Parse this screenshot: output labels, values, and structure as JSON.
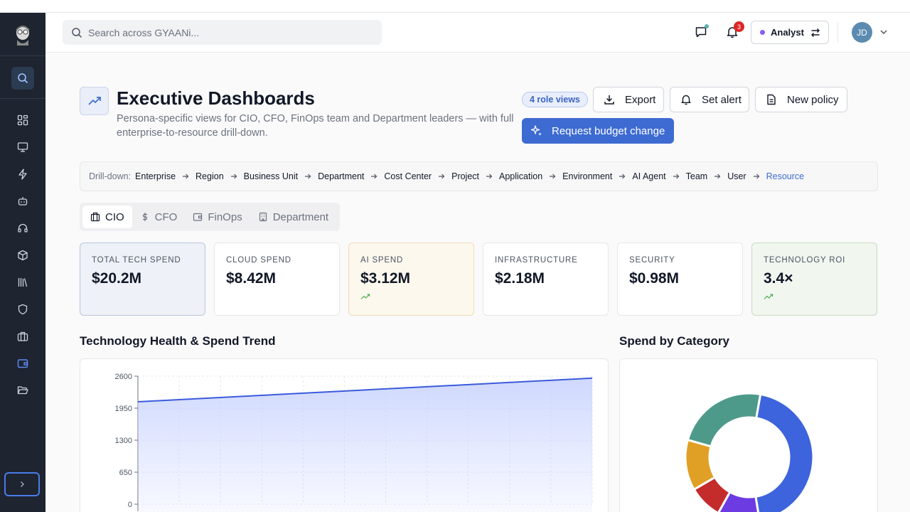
{
  "header": {
    "search_placeholder": "Search across GYAANi...",
    "notification_count": "3",
    "role_label": "Analyst",
    "avatar_initials": "JD"
  },
  "page": {
    "title": "Executive Dashboards",
    "subtitle": "Persona-specific views for CIO, CFO, FinOps team and Department leaders — with full enterprise-to-resource drill-down.",
    "role_views_pill": "4 role views",
    "export_label": "Export",
    "set_alert_label": "Set alert",
    "new_policy_label": "New policy",
    "request_budget_label": "Request budget change"
  },
  "drilldown": {
    "label": "Drill-down:",
    "items": [
      "Enterprise",
      "Region",
      "Business Unit",
      "Department",
      "Cost Center",
      "Project",
      "Application",
      "Environment",
      "AI Agent",
      "Team",
      "User",
      "Resource"
    ]
  },
  "tabs": [
    {
      "label": "CIO",
      "icon": "building-icon"
    },
    {
      "label": "CFO",
      "icon": "dollar-icon"
    },
    {
      "label": "FinOps",
      "icon": "wallet-icon"
    },
    {
      "label": "Department",
      "icon": "office-icon"
    }
  ],
  "kpis": [
    {
      "label": "TOTAL TECH SPEND",
      "value": "$20.2M"
    },
    {
      "label": "CLOUD SPEND",
      "value": "$8.42M"
    },
    {
      "label": "AI SPEND",
      "value": "$3.12M",
      "trend": "up"
    },
    {
      "label": "INFRASTRUCTURE",
      "value": "$2.18M"
    },
    {
      "label": "SECURITY",
      "value": "$0.98M"
    },
    {
      "label": "TECHNOLOGY ROI",
      "value": "3.4×",
      "trend": "up"
    }
  ],
  "sections": {
    "trend_title": "Technology Health & Spend Trend",
    "category_title": "Spend by Category"
  },
  "chart_data": [
    {
      "type": "area",
      "title": "Technology Health & Spend Trend",
      "y_ticks": [
        "2600",
        "1950",
        "1300",
        "650",
        "0"
      ],
      "ylim": [
        0,
        2600
      ],
      "x": [
        0,
        11
      ],
      "values": [
        2080,
        2560
      ],
      "grid": true,
      "colors": {
        "line": "#3b5bdb",
        "fill": "#c7d2fe"
      }
    },
    {
      "type": "pie",
      "title": "Spend by Category",
      "values": [
        42,
        10,
        8,
        12,
        22
      ],
      "colors": [
        "#3d63dd",
        "#6d3be2",
        "#c42b2b",
        "#e0a025",
        "#4e9a8a"
      ]
    }
  ],
  "colors": {
    "accent": "#3d6bd1",
    "sidebar": "#1e2430"
  }
}
